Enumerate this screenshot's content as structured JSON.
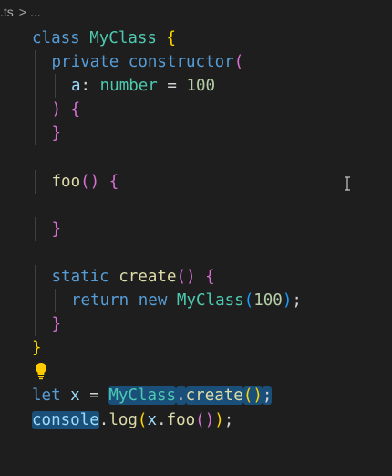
{
  "breadcrumb": {
    "file": ".ts",
    "separator": ">",
    "tail": "..."
  },
  "code": {
    "lines": [
      {
        "indent": 1,
        "tokens": [
          {
            "t": "class ",
            "c": "kw"
          },
          {
            "t": "MyClass",
            "c": "type"
          },
          {
            "t": " ",
            "c": "op"
          },
          {
            "t": "{",
            "c": "b1"
          }
        ]
      },
      {
        "indent": 2,
        "tokens": [
          {
            "t": "private ",
            "c": "kw"
          },
          {
            "t": "constructor",
            "c": "kw"
          },
          {
            "t": "(",
            "c": "b2"
          }
        ]
      },
      {
        "indent": 3,
        "tokens": [
          {
            "t": "a",
            "c": "var"
          },
          {
            "t": ": ",
            "c": "op"
          },
          {
            "t": "number",
            "c": "type"
          },
          {
            "t": " = ",
            "c": "op"
          },
          {
            "t": "100",
            "c": "num"
          }
        ]
      },
      {
        "indent": 2,
        "tokens": [
          {
            "t": ")",
            "c": "b2"
          },
          {
            "t": " ",
            "c": "op"
          },
          {
            "t": "{",
            "c": "b2"
          }
        ]
      },
      {
        "indent": 2,
        "tokens": [
          {
            "t": "}",
            "c": "b2"
          }
        ]
      },
      {
        "indent": 0,
        "tokens": []
      },
      {
        "indent": 2,
        "tokens": [
          {
            "t": "foo",
            "c": "fn"
          },
          {
            "t": "()",
            "c": "b2"
          },
          {
            "t": " ",
            "c": "op"
          },
          {
            "t": "{",
            "c": "b2"
          }
        ]
      },
      {
        "indent": 0,
        "tokens": []
      },
      {
        "indent": 2,
        "tokens": [
          {
            "t": "}",
            "c": "b2"
          }
        ]
      },
      {
        "indent": 0,
        "tokens": []
      },
      {
        "indent": 2,
        "tokens": [
          {
            "t": "static ",
            "c": "kw"
          },
          {
            "t": "create",
            "c": "fn"
          },
          {
            "t": "()",
            "c": "b2"
          },
          {
            "t": " ",
            "c": "op"
          },
          {
            "t": "{",
            "c": "b2"
          }
        ]
      },
      {
        "indent": 3,
        "tokens": [
          {
            "t": "return ",
            "c": "kw"
          },
          {
            "t": "new ",
            "c": "kw"
          },
          {
            "t": "MyClass",
            "c": "type"
          },
          {
            "t": "(",
            "c": "b3"
          },
          {
            "t": "100",
            "c": "num"
          },
          {
            "t": ")",
            "c": "b3"
          },
          {
            "t": ";",
            "c": "op"
          }
        ]
      },
      {
        "indent": 2,
        "tokens": [
          {
            "t": "}",
            "c": "b2"
          }
        ]
      },
      {
        "indent": 1,
        "tokens": [
          {
            "t": "}",
            "c": "b1"
          }
        ]
      },
      {
        "indent": 0,
        "tokens": []
      },
      {
        "indent": 1,
        "tokens": [
          {
            "t": "let ",
            "c": "kw"
          },
          {
            "t": "x",
            "c": "var"
          },
          {
            "t": " = ",
            "c": "op"
          },
          {
            "t": "MyClass",
            "c": "type",
            "hl": true
          },
          {
            "t": ".",
            "c": "op",
            "hl": true
          },
          {
            "t": "create",
            "c": "fn",
            "hl": true
          },
          {
            "t": "()",
            "c": "b1",
            "hl": true
          },
          {
            "t": ";",
            "c": "op",
            "hl": true
          }
        ]
      },
      {
        "indent": 1,
        "tokens": [
          {
            "t": "console",
            "c": "var",
            "hl": true
          },
          {
            "t": ".",
            "c": "op"
          },
          {
            "t": "log",
            "c": "fn"
          },
          {
            "t": "(",
            "c": "b1"
          },
          {
            "t": "x",
            "c": "var"
          },
          {
            "t": ".",
            "c": "op"
          },
          {
            "t": "foo",
            "c": "fn"
          },
          {
            "t": "()",
            "c": "b2"
          },
          {
            "t": ")",
            "c": "b1"
          },
          {
            "t": ";",
            "c": "op"
          }
        ]
      }
    ]
  },
  "icons": {
    "lightbulb": "lightbulb-icon",
    "cursor": "text-cursor-icon"
  },
  "colors": {
    "background": "#1e1e1e",
    "keyword": "#569cd6",
    "type": "#4ec9b0",
    "function": "#dcdcaa",
    "variable": "#9cdcfe",
    "number": "#b5cea8",
    "selection": "#1a4f7a",
    "lightbulb": "#ffcc00"
  }
}
